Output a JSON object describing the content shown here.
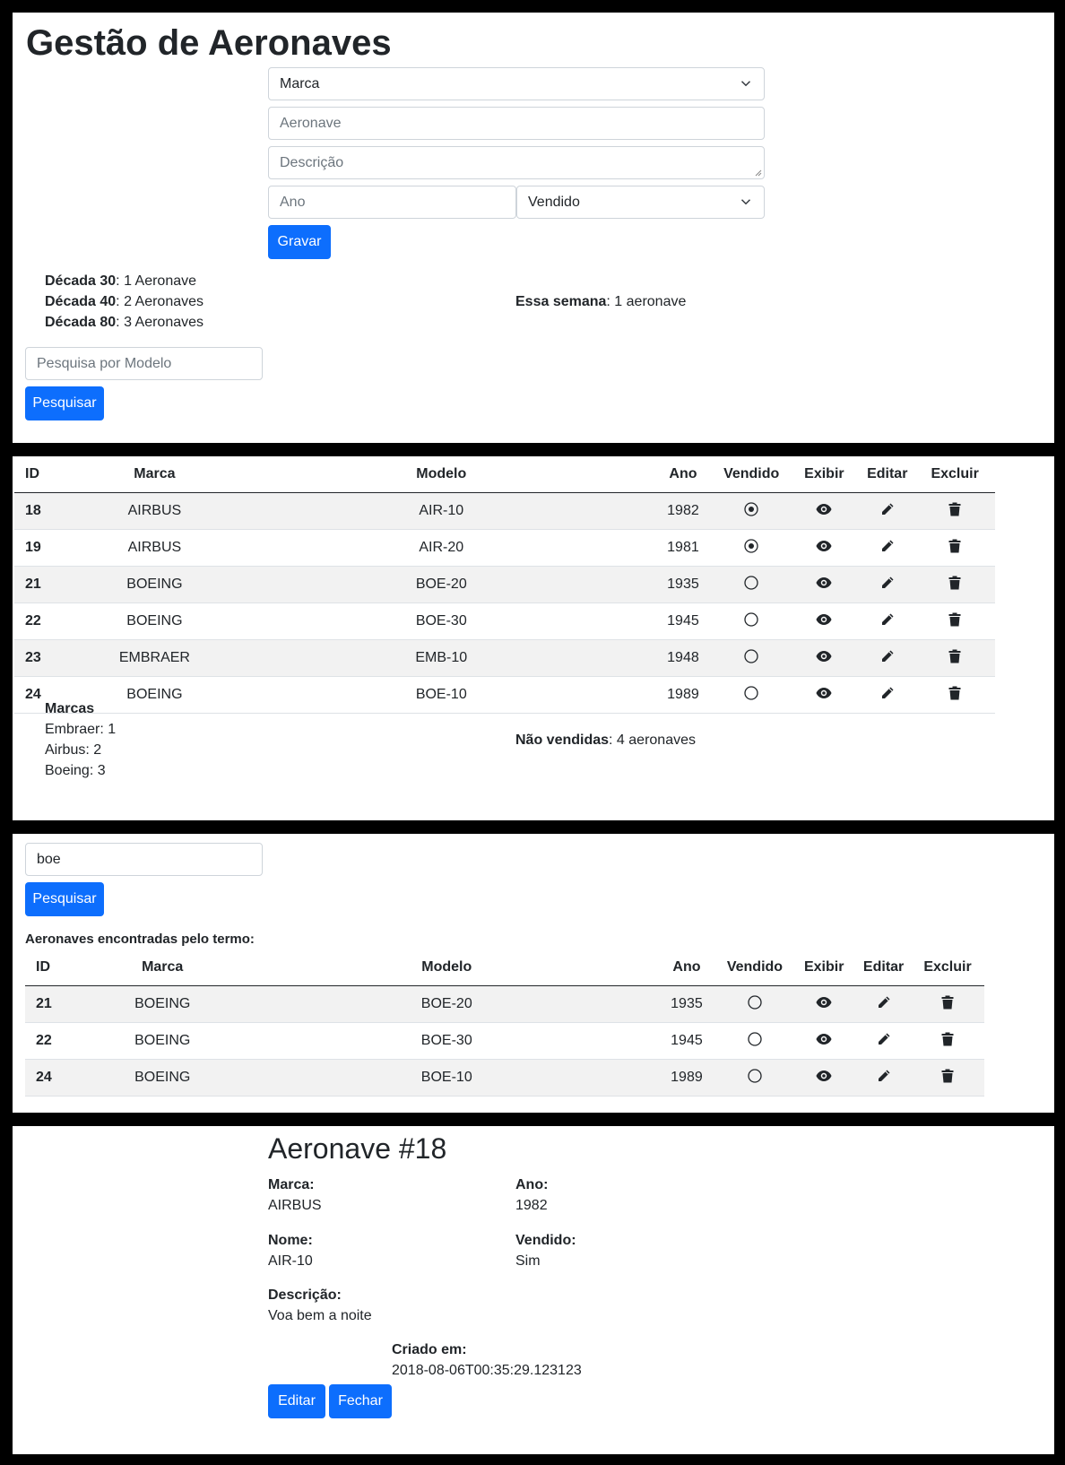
{
  "form": {
    "title": "Gestão de Aeronaves",
    "marca_select": "Marca",
    "aeronave_placeholder": "Aeronave",
    "descricao_placeholder": "Descrição",
    "ano_placeholder": "Ano",
    "vendido_select": "Vendido",
    "gravar_label": "Gravar"
  },
  "stats": {
    "decadas": [
      {
        "label": "Década 30",
        "value": ": 1 Aeronave"
      },
      {
        "label": "Década 40",
        "value": ": 2 Aeronaves"
      },
      {
        "label": "Década 80",
        "value": ": 3 Aeronaves"
      }
    ],
    "semana_label": "Essa semana",
    "semana_value": ": 1 aeronave"
  },
  "search1": {
    "placeholder": "Pesquisa por Modelo",
    "button": "Pesquisar"
  },
  "table": {
    "headers": [
      "ID",
      "Marca",
      "Modelo",
      "Ano",
      "Vendido",
      "Exibir",
      "Editar",
      "Excluir"
    ],
    "rows": [
      {
        "id": "18",
        "marca": "AIRBUS",
        "modelo": "AIR-10",
        "ano": "1982",
        "vendido": true
      },
      {
        "id": "19",
        "marca": "AIRBUS",
        "modelo": "AIR-20",
        "ano": "1981",
        "vendido": true
      },
      {
        "id": "21",
        "marca": "BOEING",
        "modelo": "BOE-20",
        "ano": "1935",
        "vendido": false
      },
      {
        "id": "22",
        "marca": "BOEING",
        "modelo": "BOE-30",
        "ano": "1945",
        "vendido": false
      },
      {
        "id": "23",
        "marca": "EMBRAER",
        "modelo": "EMB-10",
        "ano": "1948",
        "vendido": false
      },
      {
        "id": "24",
        "marca": "BOEING",
        "modelo": "BOE-10",
        "ano": "1989",
        "vendido": false
      }
    ]
  },
  "marcas": {
    "title": "Marcas",
    "items": [
      "Embraer: 1",
      "Airbus: 2",
      "Boeing: 3"
    ],
    "nao_vendidas_label": "Não vendidas",
    "nao_vendidas_value": ": 4 aeronaves"
  },
  "search2": {
    "value": "boe",
    "button": "Pesquisar",
    "result_title": "Aeronaves encontradas pelo termo:",
    "headers": [
      "ID",
      "Marca",
      "Modelo",
      "Ano",
      "Vendido",
      "Exibir",
      "Editar",
      "Excluir"
    ],
    "rows": [
      {
        "id": "21",
        "marca": "BOEING",
        "modelo": "BOE-20",
        "ano": "1935",
        "vendido": false
      },
      {
        "id": "22",
        "marca": "BOEING",
        "modelo": "BOE-30",
        "ano": "1945",
        "vendido": false
      },
      {
        "id": "24",
        "marca": "BOEING",
        "modelo": "BOE-10",
        "ano": "1989",
        "vendido": false
      }
    ]
  },
  "detail": {
    "title": "Aeronave #18",
    "marca_label": "Marca:",
    "marca_value": "AIRBUS",
    "ano_label": "Ano:",
    "ano_value": "1982",
    "nome_label": "Nome:",
    "nome_value": "AIR-10",
    "vendido_label": "Vendido:",
    "vendido_value": "Sim",
    "descricao_label": "Descrição:",
    "descricao_value": "Voa bem a noite",
    "criado_label": "Criado em:",
    "criado_value": "2018-08-06T00:35:29.123123",
    "editar_button": "Editar",
    "fechar_button": "Fechar"
  },
  "colors": {
    "primary": "#0d6efd",
    "stripe": "#f2f2f2",
    "text": "#212529"
  }
}
